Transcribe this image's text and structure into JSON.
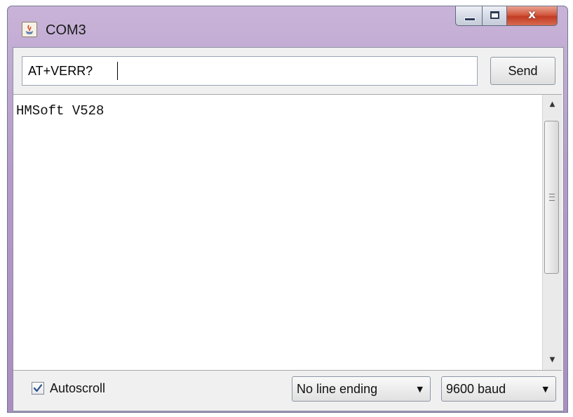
{
  "window": {
    "title": "COM3",
    "icon": "java-cup-icon"
  },
  "window_controls": {
    "close_glyph": "x"
  },
  "command": {
    "value": "AT+VERR?"
  },
  "send_label": "Send",
  "output": {
    "text": "HMSoft V528"
  },
  "footer": {
    "autoscroll_label": "Autoscroll",
    "autoscroll_checked": true,
    "line_ending": "No line ending",
    "baud_rate": "9600 baud"
  },
  "icons": [
    "java-cup-icon",
    "minimize-icon",
    "maximize-icon",
    "close-icon",
    "scroll-up-arrow-icon",
    "scroll-down-arrow-icon",
    "checkmark-icon",
    "dropdown-arrow-icon"
  ]
}
